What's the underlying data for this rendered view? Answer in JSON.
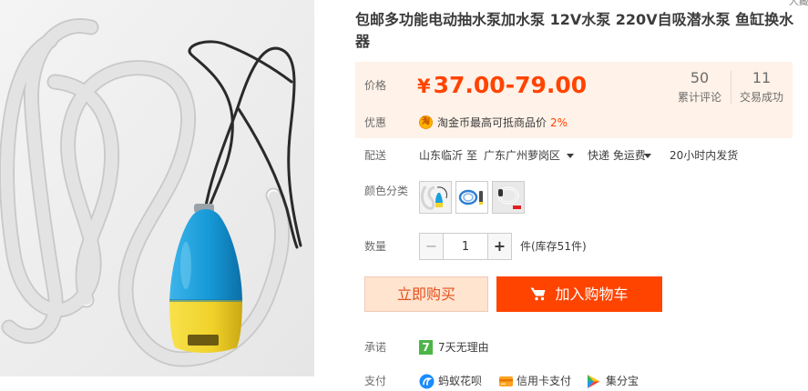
{
  "header": {
    "corner_text": "人藏"
  },
  "product": {
    "title": "包邮多功能电动抽水泵加水泵 12V水泵 220V自吸潜水泵 鱼缸换水器"
  },
  "price": {
    "label": "价格",
    "currency": "¥",
    "range": "37.00-79.00"
  },
  "stats": [
    {
      "value": "50",
      "label": "累计评论"
    },
    {
      "value": "11",
      "label": "交易成功"
    }
  ],
  "promo": {
    "label": "优惠",
    "icon": "taojinbi-coin-icon",
    "icon_glyph": "淘",
    "text": "淘金币最高可抵商品价",
    "rate": "2%"
  },
  "delivery": {
    "label": "配送",
    "origin": "山东临沂",
    "to": "至",
    "destination": "广东广州萝岗区",
    "shipping": "快递 免运费",
    "dispatch": "20小时内发货"
  },
  "sku": {
    "label": "颜色分类",
    "options": [
      {
        "icon": "pump-with-hose-thumbnail"
      },
      {
        "icon": "blue-pump-thumbnail"
      },
      {
        "icon": "pump-kit-thumbnail"
      }
    ]
  },
  "quantity": {
    "label": "数量",
    "decrement": "−",
    "value": "1",
    "increment": "+",
    "unit_stock": "件(库存51件)"
  },
  "actions": {
    "buy_now": "立即购买",
    "add_to_cart": "加入购物车",
    "cart_icon": "cart-icon"
  },
  "promise": {
    "label": "承诺",
    "badge": "7",
    "text": "7天无理由"
  },
  "payment": {
    "label": "支付",
    "methods": [
      {
        "icon": "huabei-icon",
        "label": "蚂蚁花呗"
      },
      {
        "icon": "credit-card-icon",
        "label": "信用卡支付"
      },
      {
        "icon": "jifenbao-icon",
        "label": "集分宝"
      }
    ]
  },
  "colors": {
    "accent": "#ff4400",
    "price_panel": "#fff2e8",
    "buy_now_bg": "#ffe4d0",
    "buy_now_border": "#f0cab6",
    "promise_green": "#4cb548",
    "text": "#3c3c3c",
    "muted": "#6c6c6c"
  }
}
